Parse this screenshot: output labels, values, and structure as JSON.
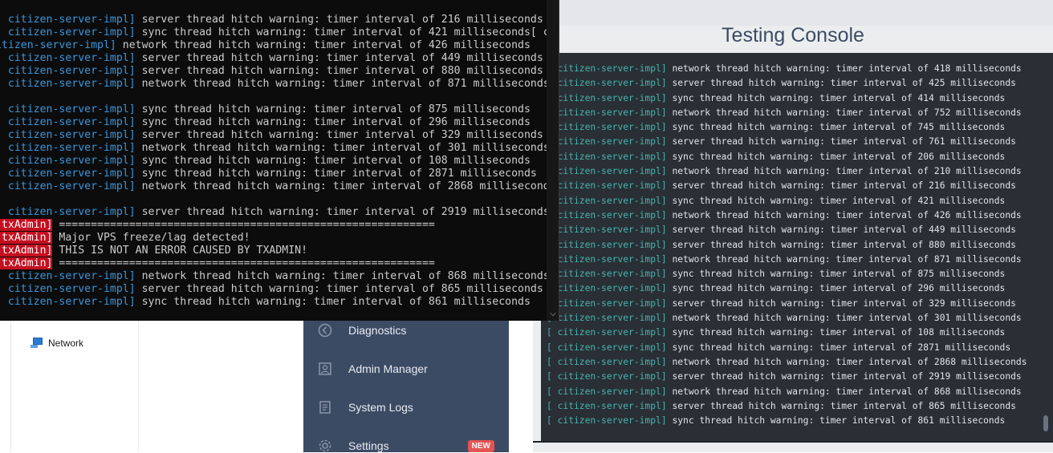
{
  "explorer": {
    "items": [
      {
        "label": "Network",
        "icon": "network-icon"
      }
    ]
  },
  "sidebar": {
    "items": [
      {
        "label": "Diagnostics",
        "icon": "diagnostics-icon"
      },
      {
        "label": "Admin Manager",
        "icon": "admin-manager-icon"
      },
      {
        "label": "System Logs",
        "icon": "system-logs-icon"
      },
      {
        "label": "Settings",
        "icon": "gear-icon",
        "badge": "NEW"
      }
    ]
  },
  "test_console": {
    "title": "Testing Console",
    "rows": [
      {
        "ctx": "[ citizen-server-impl]",
        "msg": " network thread hitch warning: timer interval of 418 milliseconds"
      },
      {
        "ctx": "[ citizen-server-impl]",
        "msg": " server thread hitch warning: timer interval of 425 milliseconds"
      },
      {
        "ctx": "[ citizen-server-impl]",
        "msg": " sync thread hitch warning: timer interval of 414 milliseconds"
      },
      {
        "ctx": "[ citizen-server-impl]",
        "msg": " network thread hitch warning: timer interval of 752 milliseconds"
      },
      {
        "ctx": "[ citizen-server-impl]",
        "msg": " sync thread hitch warning: timer interval of 745 milliseconds"
      },
      {
        "ctx": "[ citizen-server-impl]",
        "msg": " server thread hitch warning: timer interval of 761 milliseconds"
      },
      {
        "ctx": "[ citizen-server-impl]",
        "msg": " sync thread hitch warning: timer interval of 206 milliseconds"
      },
      {
        "ctx": "[ citizen-server-impl]",
        "msg": " network thread hitch warning: timer interval of 210 milliseconds"
      },
      {
        "ctx": "[ citizen-server-impl]",
        "msg": " server thread hitch warning: timer interval of 216 milliseconds"
      },
      {
        "ctx": "[ citizen-server-impl]",
        "msg": " sync thread hitch warning: timer interval of 421 milliseconds"
      },
      {
        "ctx": "[ citizen-server-impl]",
        "msg": " network thread hitch warning: timer interval of 426 milliseconds"
      },
      {
        "ctx": "[ citizen-server-impl]",
        "msg": " server thread hitch warning: timer interval of 449 milliseconds"
      },
      {
        "ctx": "[ citizen-server-impl]",
        "msg": " server thread hitch warning: timer interval of 880 milliseconds"
      },
      {
        "ctx": "[ citizen-server-impl]",
        "msg": " network thread hitch warning: timer interval of 871 milliseconds"
      },
      {
        "ctx": "[ citizen-server-impl]",
        "msg": " sync thread hitch warning: timer interval of 875 milliseconds"
      },
      {
        "ctx": "[ citizen-server-impl]",
        "msg": " sync thread hitch warning: timer interval of 296 milliseconds"
      },
      {
        "ctx": "[ citizen-server-impl]",
        "msg": " server thread hitch warning: timer interval of 329 milliseconds"
      },
      {
        "ctx": "[ citizen-server-impl]",
        "msg": " network thread hitch warning: timer interval of 301 milliseconds"
      },
      {
        "ctx": "[ citizen-server-impl]",
        "msg": " sync thread hitch warning: timer interval of 108 milliseconds"
      },
      {
        "ctx": "[ citizen-server-impl]",
        "msg": " sync thread hitch warning: timer interval of 2871 milliseconds"
      },
      {
        "ctx": "[ citizen-server-impl]",
        "msg": " network thread hitch warning: timer interval of 2868 milliseconds"
      },
      {
        "ctx": "[ citizen-server-impl]",
        "msg": " server thread hitch warning: timer interval of 2919 milliseconds"
      },
      {
        "ctx": "[ citizen-server-impl]",
        "msg": " network thread hitch warning: timer interval of 868 milliseconds"
      },
      {
        "ctx": "[ citizen-server-impl]",
        "msg": " server thread hitch warning: timer interval of 865 milliseconds"
      },
      {
        "ctx": "[ citizen-server-impl]",
        "msg": " sync thread hitch warning: timer interval of 861 milliseconds"
      }
    ]
  },
  "cmd": {
    "lines": [
      {
        "ctx": "[ citizen-server-impl]",
        "msg": " server thread hitch warning: timer interval of 216 milliseconds"
      },
      {
        "ctx": "[ citizen-server-impl]",
        "msg": " sync thread hitch warning: timer interval of 421 milliseconds[ c"
      },
      {
        "ctx": "itizen-server-impl]",
        "msg": " network thread hitch warning: timer interval of 426 milliseconds"
      },
      {
        "ctx": "[ citizen-server-impl]",
        "msg": " server thread hitch warning: timer interval of 449 milliseconds"
      },
      {
        "ctx": "[ citizen-server-impl]",
        "msg": " server thread hitch warning: timer interval of 880 milliseconds"
      },
      {
        "ctx": "[ citizen-server-impl]",
        "msg": " network thread hitch warning: timer interval of 871 milliseconds"
      },
      {
        "ctx": "",
        "msg": ""
      },
      {
        "ctx": "[ citizen-server-impl]",
        "msg": " sync thread hitch warning: timer interval of 875 milliseconds"
      },
      {
        "ctx": "[ citizen-server-impl]",
        "msg": " sync thread hitch warning: timer interval of 296 milliseconds"
      },
      {
        "ctx": "[ citizen-server-impl]",
        "msg": " server thread hitch warning: timer interval of 329 milliseconds"
      },
      {
        "ctx": "[ citizen-server-impl]",
        "msg": " network thread hitch warning: timer interval of 301 milliseconds"
      },
      {
        "ctx": "[ citizen-server-impl]",
        "msg": " sync thread hitch warning: timer interval of 108 milliseconds"
      },
      {
        "ctx": "[ citizen-server-impl]",
        "msg": " sync thread hitch warning: timer interval of 2871 milliseconds"
      },
      {
        "ctx": "[ citizen-server-impl]",
        "msg": " network thread hitch warning: timer interval of 2868 millisecond"
      },
      {
        "ctx": "",
        "msg": ""
      },
      {
        "ctx": "[ citizen-server-impl]",
        "msg": " server thread hitch warning: timer interval of 2919 milliseconds"
      },
      {
        "tx": "[txAdmin]",
        "msg": " ==========================================================="
      },
      {
        "tx": "[txAdmin]",
        "msg": " Major VPS freeze/lag detected!"
      },
      {
        "tx": "[txAdmin]",
        "msg": " THIS IS NOT AN ERROR CAUSED BY TXADMIN!"
      },
      {
        "tx": "[txAdmin]",
        "msg": " ==========================================================="
      },
      {
        "ctx": "[ citizen-server-impl]",
        "msg": " network thread hitch warning: timer interval of 868 milliseconds"
      },
      {
        "ctx": "[ citizen-server-impl]",
        "msg": " server thread hitch warning: timer interval of 865 milliseconds"
      },
      {
        "ctx": "[ citizen-server-impl]",
        "msg": " sync thread hitch warning: timer interval of 861 milliseconds"
      }
    ]
  },
  "colors": {
    "sidebar_bg": "#3c4b64",
    "badge_red": "#e55353",
    "console_bg": "#2a2f35",
    "context_teal": "#48b3ae",
    "cmd_context_blue": "#3a96dd",
    "txadmin_red": "#c50f1f"
  }
}
